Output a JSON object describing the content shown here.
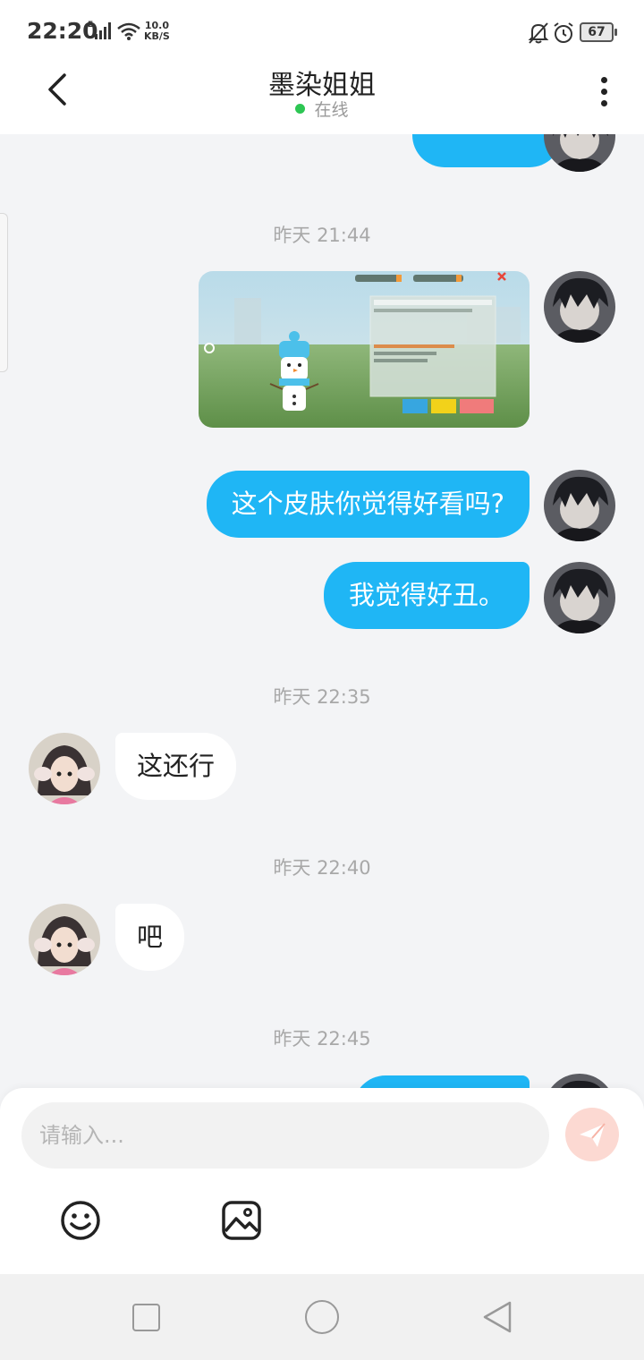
{
  "status_bar": {
    "time": "22:20",
    "network_type": "E",
    "speed_value": "10.0",
    "speed_unit": "KB/S",
    "battery": "67",
    "icons": [
      "signal-icon",
      "wifi-icon",
      "bell-muted-icon",
      "alarm-icon",
      "battery-icon"
    ]
  },
  "header": {
    "title": "墨染姐姐",
    "status": "在线",
    "status_color": "#2dc653",
    "icons": [
      "back-arrow-icon",
      "more-vertical-icon"
    ]
  },
  "messages": [
    {
      "direction": "out",
      "type": "text",
      "text": "············"
    },
    {
      "type": "timestamp",
      "text": "昨天 21:44"
    },
    {
      "direction": "out",
      "type": "image",
      "description_icon": "game-screenshot-image"
    },
    {
      "direction": "out",
      "type": "text",
      "text": "这个皮肤你觉得好看吗?"
    },
    {
      "direction": "out",
      "type": "text",
      "text": "我觉得好丑。"
    },
    {
      "type": "timestamp",
      "text": "昨天 22:35"
    },
    {
      "direction": "in",
      "type": "text",
      "text": "这还行"
    },
    {
      "type": "timestamp",
      "text": "昨天 22:40"
    },
    {
      "direction": "in",
      "type": "text",
      "text": "吧"
    },
    {
      "type": "timestamp",
      "text": "昨天 22:45"
    }
  ],
  "input": {
    "placeholder": "请输入..."
  },
  "toolbar_icons": [
    "emoji-icon",
    "image-icon",
    "send-icon"
  ],
  "colors": {
    "accent": "#1fb6f5",
    "background": "#f3f4f6",
    "send_button": "#fcd9d2"
  }
}
